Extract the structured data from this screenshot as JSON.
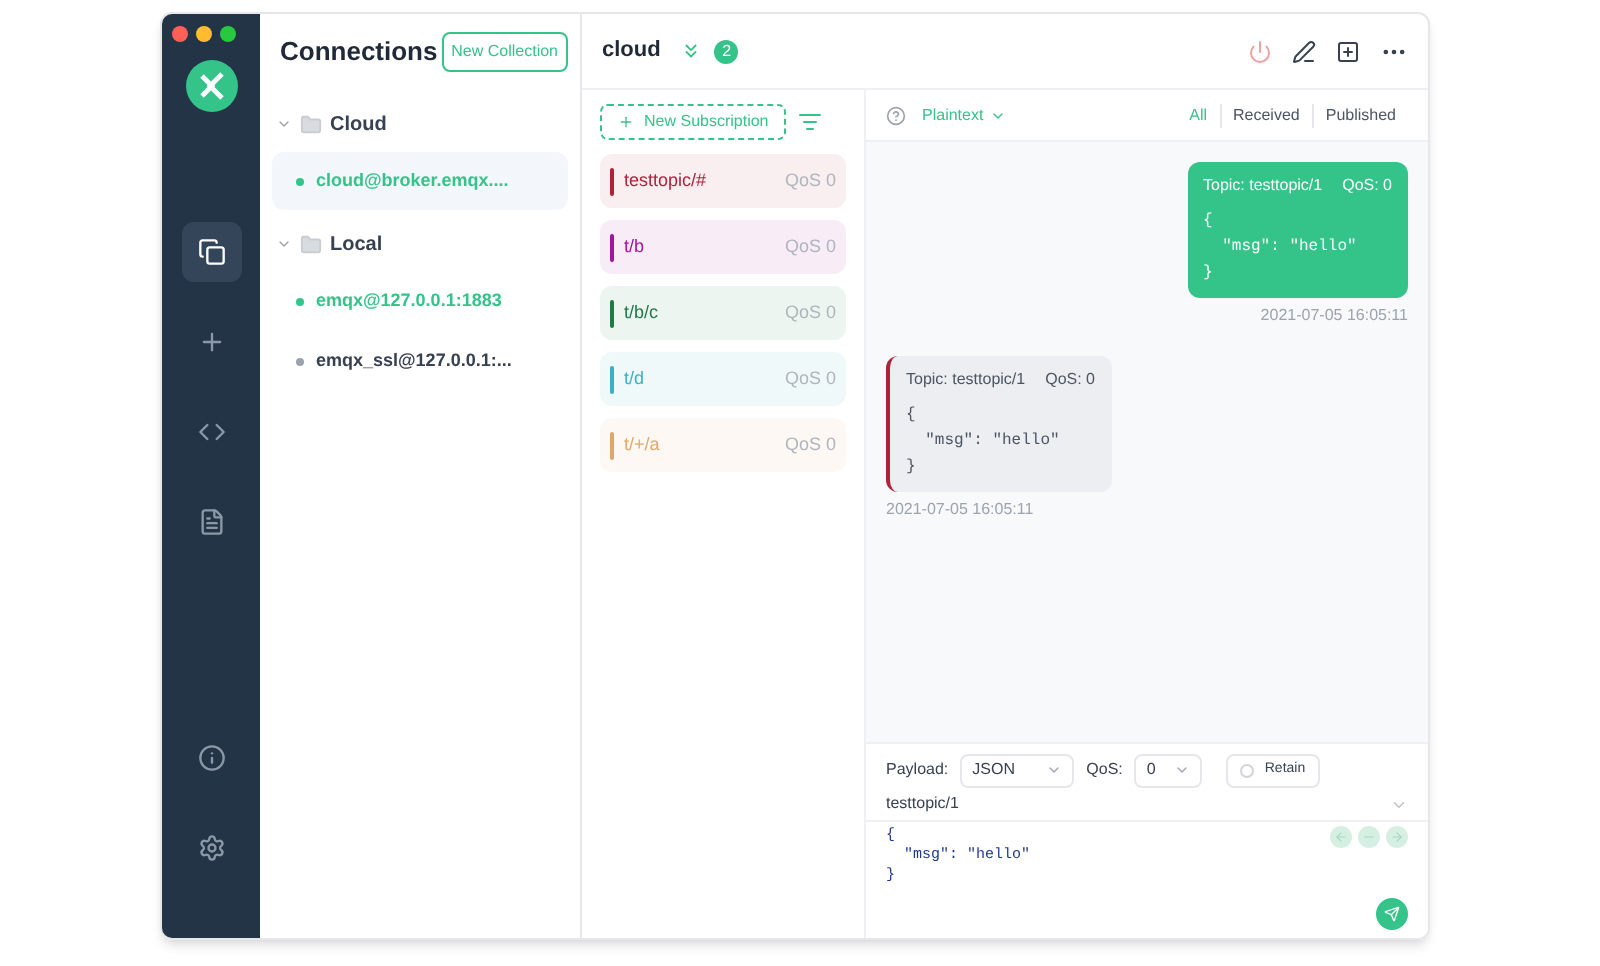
{
  "sidebar": {
    "items": [
      {
        "kind": "connections",
        "selected": true
      },
      {
        "kind": "new",
        "selected": false
      },
      {
        "kind": "script",
        "selected": false
      },
      {
        "kind": "log",
        "selected": false
      }
    ],
    "bottom_items": [
      {
        "kind": "about"
      },
      {
        "kind": "settings"
      }
    ]
  },
  "connections": {
    "title": "Connections",
    "new_collection": "New Collection",
    "groups": [
      {
        "name": "Cloud",
        "expanded": true,
        "items": [
          {
            "name": "cloud@broker.emqx....",
            "online": true,
            "selected": true
          }
        ]
      },
      {
        "name": "Local",
        "expanded": true,
        "items": [
          {
            "name": "emqx@127.0.0.1:1883",
            "online": true,
            "selected": false
          },
          {
            "name": "emqx_ssl@127.0.0.1:...",
            "online": false,
            "selected": false
          }
        ]
      }
    ]
  },
  "header": {
    "title": "cloud",
    "badge": "2"
  },
  "subscriptions": {
    "new_button": "New Subscription",
    "items": [
      {
        "topic": "testtopic/#",
        "qos": "QoS 0",
        "color": "#b0213a"
      },
      {
        "topic": "t/b",
        "qos": "QoS 0",
        "color": "#a3159a"
      },
      {
        "topic": "t/b/c",
        "qos": "QoS 0",
        "color": "#1f7a45"
      },
      {
        "topic": "t/d",
        "qos": "QoS 0",
        "color": "#3ab0c4"
      },
      {
        "topic": "t/+/a",
        "qos": "QoS 0",
        "color": "#e0a868"
      }
    ]
  },
  "messages": {
    "format": "Plaintext",
    "filters": [
      {
        "label": "All",
        "selected": true
      },
      {
        "label": "Received",
        "selected": false
      },
      {
        "label": "Published",
        "selected": false
      }
    ],
    "items": [
      {
        "kind": "sent",
        "topic": "Topic: testtopic/1",
        "qos": "QoS: 0",
        "payload": "{\n  \"msg\": \"hello\"\n}",
        "time": "2021-07-05 16:05:11"
      },
      {
        "kind": "received",
        "topic": "Topic: testtopic/1",
        "qos": "QoS: 0",
        "payload": "{\n  \"msg\": \"hello\"\n}",
        "time": "2021-07-05 16:05:11"
      }
    ]
  },
  "publish": {
    "payload_label": "Payload:",
    "payload_format": "JSON",
    "qos_label": "QoS:",
    "qos": "0",
    "retain": {
      "label": "Retain",
      "checked": false
    },
    "topic": "testtopic/1",
    "payload": "{\n  \"msg\": \"hello\"\n}"
  }
}
